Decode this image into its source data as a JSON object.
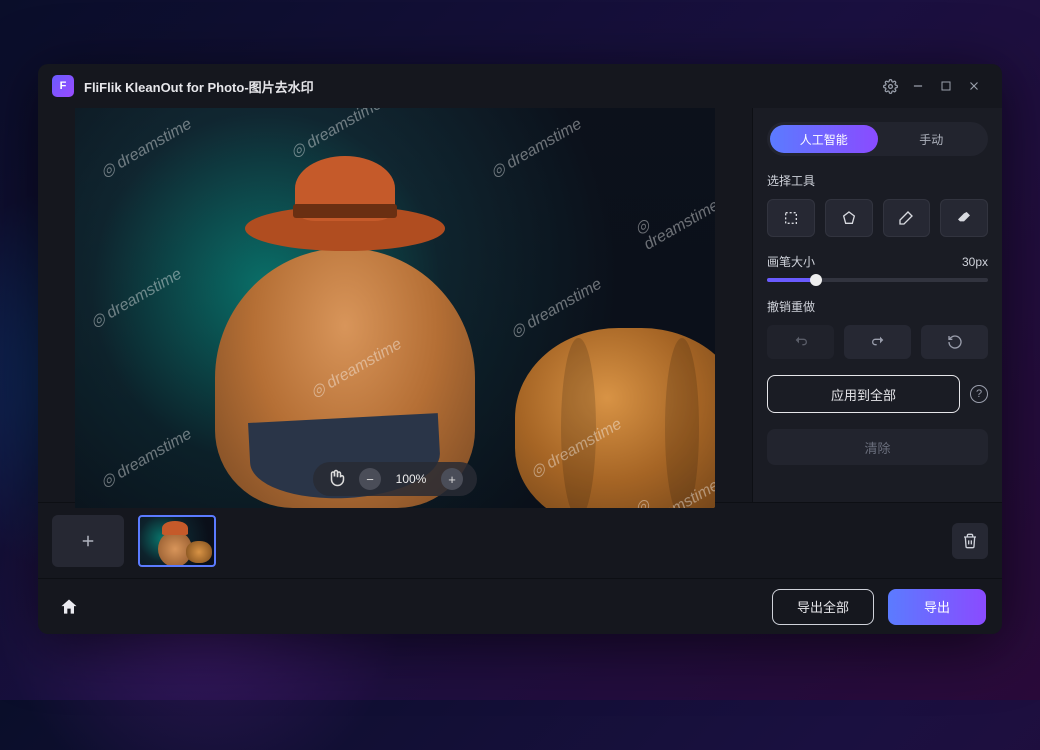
{
  "app": {
    "title": "FliFlik KleanOut for Photo-图片去水印",
    "icon_label": "F"
  },
  "canvas": {
    "zoom": "100%",
    "watermark_text": "dreamstime"
  },
  "tabs": {
    "ai": "人工智能",
    "manual": "手动"
  },
  "tools": {
    "section_label": "选择工具"
  },
  "brush": {
    "label": "画笔大小",
    "value": "30px"
  },
  "undo": {
    "label": "撤销重做"
  },
  "apply": {
    "button": "应用到全部",
    "clear": "清除"
  },
  "footer": {
    "export_all": "导出全部",
    "export": "导出"
  }
}
